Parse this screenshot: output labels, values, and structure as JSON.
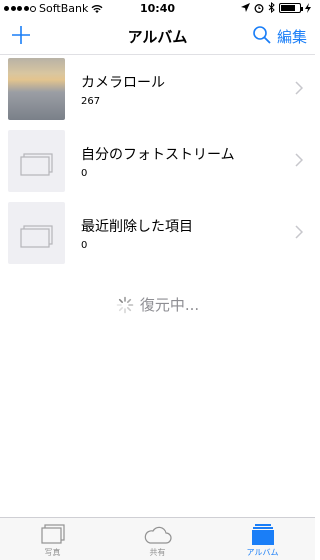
{
  "status_bar": {
    "carrier": "SoftBank",
    "time": "10:40",
    "battery_level": 0.75
  },
  "nav": {
    "title": "アルバム",
    "edit_label": "編集"
  },
  "albums": [
    {
      "title": "カメラロール",
      "count": "267"
    },
    {
      "title": "自分のフォトストリーム",
      "count": "0"
    },
    {
      "title": "最近削除した項目",
      "count": "0"
    }
  ],
  "restore": {
    "label": "復元中..."
  },
  "tabs": [
    {
      "label": "写真",
      "icon": "photos-icon"
    },
    {
      "label": "共有",
      "icon": "cloud-icon"
    },
    {
      "label": "アルバム",
      "icon": "albums-icon",
      "selected": true
    }
  ],
  "colors": {
    "accent": "#1a7ef7",
    "secondary_text": "#8e8e93",
    "tab_bar_bg": "#f7f7f7"
  }
}
